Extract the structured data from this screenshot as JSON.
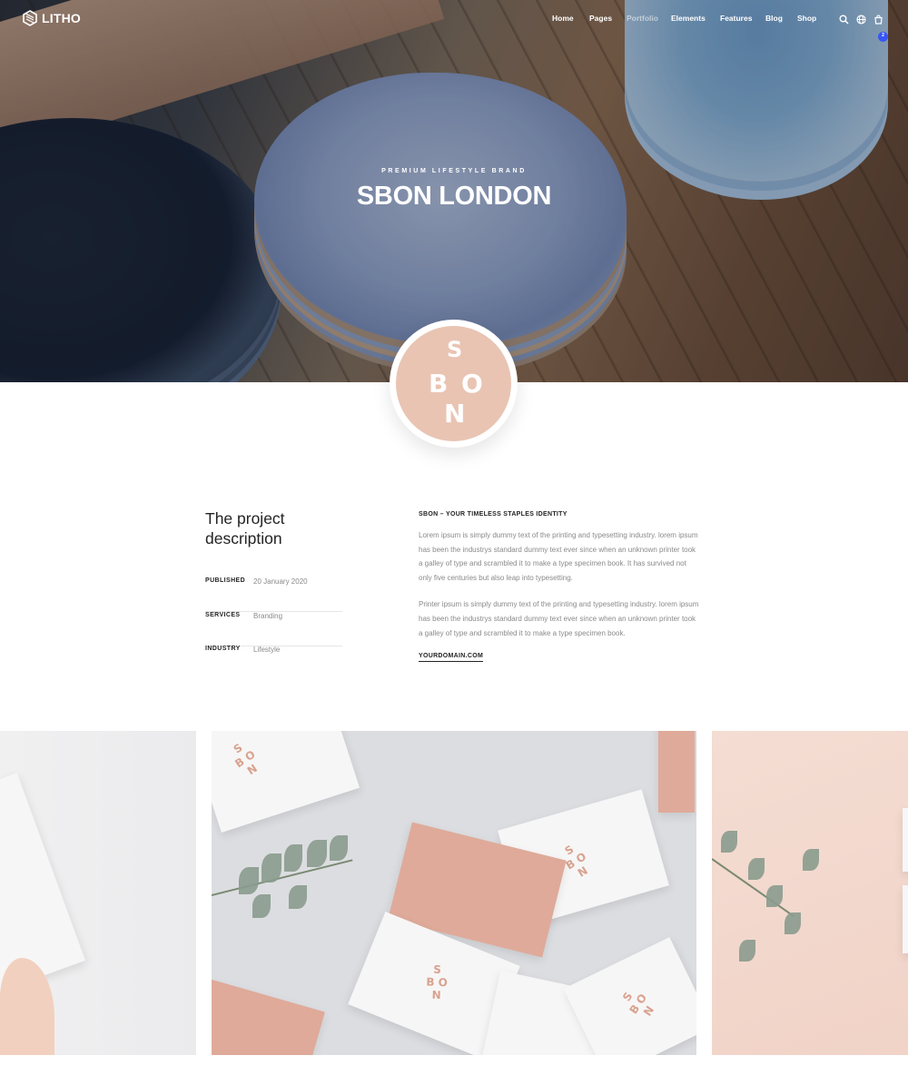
{
  "nav": {
    "logo_text": "LITHO",
    "menu": [
      "Home",
      "Pages",
      "Portfolio",
      "Elements",
      "Features",
      "Blog",
      "Shop"
    ],
    "active_item": "Portfolio",
    "cart_count": "2",
    "icons": [
      "search-icon",
      "globe-icon",
      "cart-icon"
    ]
  },
  "hero": {
    "eyebrow": "PREMIUM LIFESTYLE BRAND",
    "title": "SBON LONDON"
  },
  "brand_logo": {
    "letters": [
      "S",
      "B",
      "O",
      "N"
    ]
  },
  "project": {
    "title": "The project description",
    "meta": [
      {
        "label": "PUBLISHED",
        "value": "20 January 2020"
      },
      {
        "label": "SERVICES",
        "value": "Branding"
      },
      {
        "label": "INDUSTRY",
        "value": "Lifestyle"
      }
    ],
    "heading": "SBON – YOUR TIMELESS STAPLES IDENTITY",
    "paragraph_1": "Lorem ipsum is simply dummy text of the printing and typesetting industry. lorem ipsum has been the industrys standard dummy text ever since when an unknown printer took a galley of type and scrambled it to make a type specimen book. It has survived not only five centuries but also leap into typesetting.",
    "paragraph_2": "Printer ipsum is simply dummy text of the printing and typesetting industry. lorem ipsum has been the industrys standard dummy text ever since when an unknown printer took a galley of type and scrambled it to make a type specimen book.",
    "link": "YOURDOMAIN.COM"
  },
  "colors": {
    "accent_pink": "#e9c4b3",
    "text_dark": "#232323",
    "text_muted": "#8a8a8a",
    "badge_blue": "#3856f3"
  }
}
